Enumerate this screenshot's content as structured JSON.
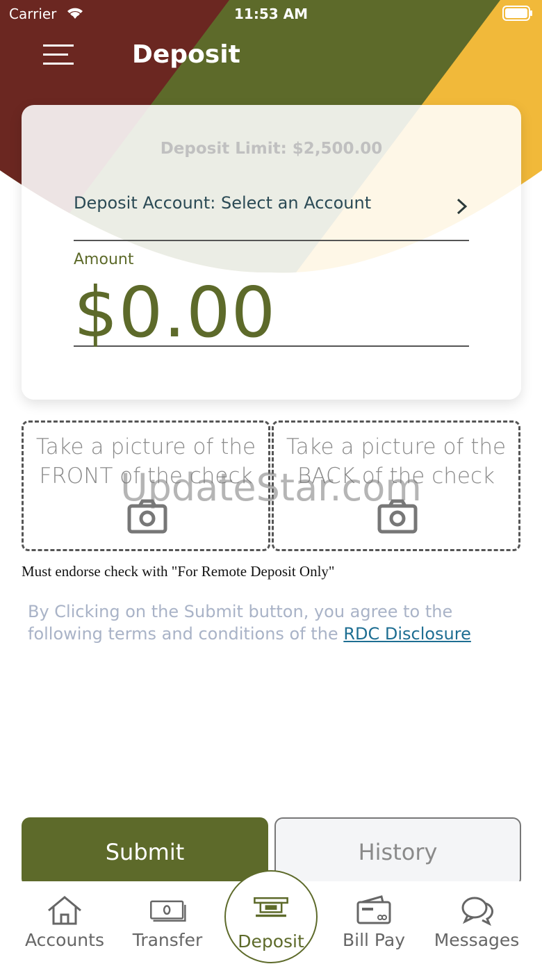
{
  "status_bar": {
    "carrier": "Carrier",
    "time": "11:53 AM"
  },
  "header": {
    "title": "Deposit",
    "menu_icon": "hamburger-menu-icon"
  },
  "colors": {
    "brand_maroon": "#6b2721",
    "brand_olive": "#5d6a2a",
    "brand_gold": "#f1b93a",
    "link_blue": "#1e6e92"
  },
  "deposit_card": {
    "limit": "Deposit Limit:  $2,500.00",
    "account_label": "Deposit Account: Select an Account",
    "amount_label": "Amount",
    "amount_value": "$0.00"
  },
  "checks": {
    "front": "Take a picture of the FRONT of the check",
    "back": "Take a picture of the BACK of the check",
    "icon": "camera-icon"
  },
  "watermark": "UpdateStar.com",
  "endorse_note": "Must endorse check with \"For Remote Deposit Only\"",
  "terms": {
    "text": "By Clicking on the Submit button, you agree to the following terms and conditions of the ",
    "link": "RDC Disclosure"
  },
  "actions": {
    "submit": "Submit",
    "history": "History"
  },
  "tabs": [
    {
      "label": "Accounts",
      "icon": "house-icon"
    },
    {
      "label": "Transfer",
      "icon": "cash-icon"
    },
    {
      "label": "Deposit",
      "icon": "atm-deposit-icon",
      "active": true
    },
    {
      "label": "Bill Pay",
      "icon": "bill-card-icon"
    },
    {
      "label": "Messages",
      "icon": "chat-bubbles-icon"
    }
  ]
}
